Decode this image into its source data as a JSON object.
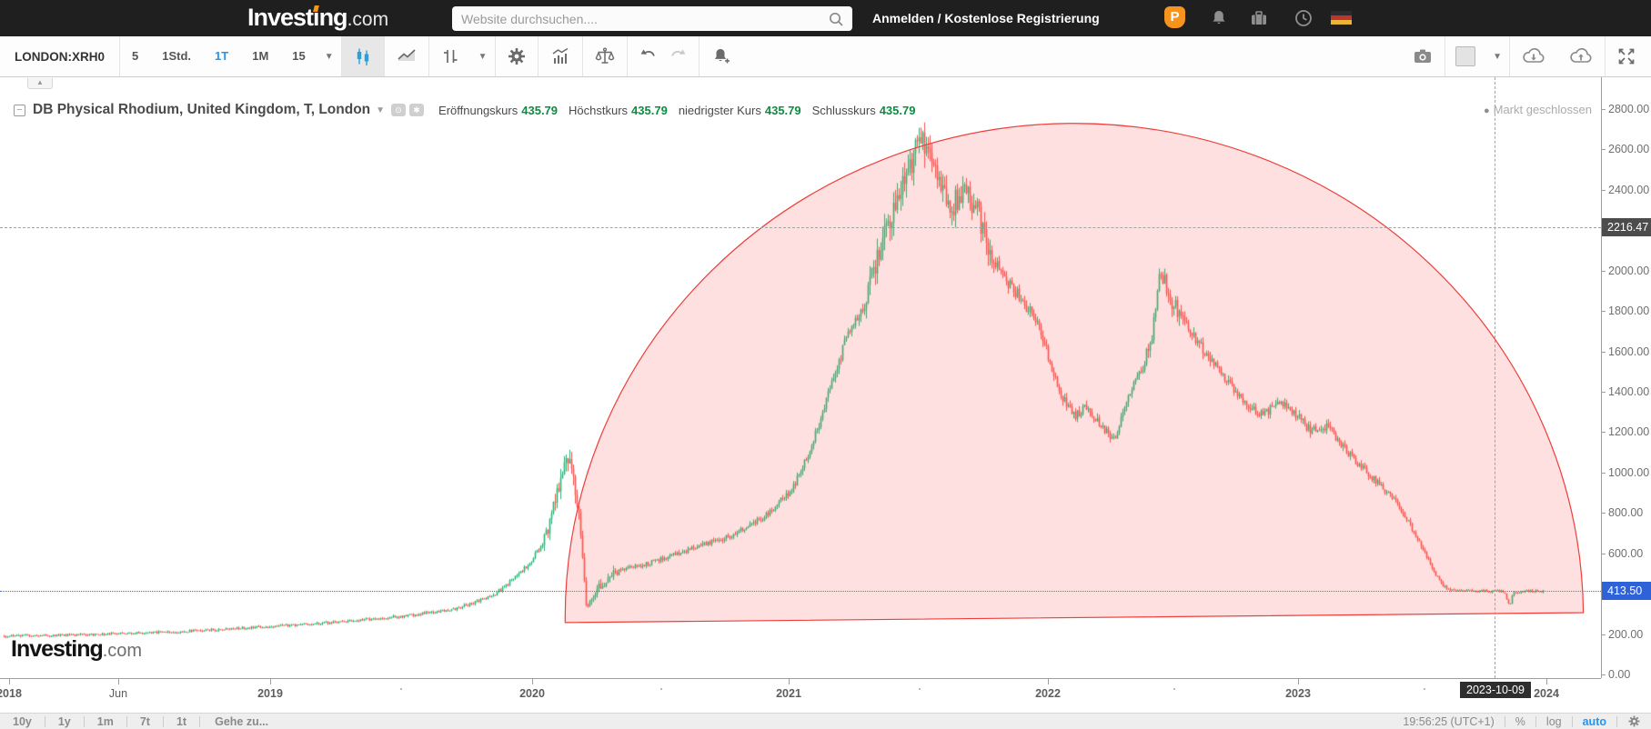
{
  "header": {
    "logo_main": "Investing",
    "logo_suffix": ".com",
    "search_placeholder": "Website durchsuchen....",
    "auth_label": "Anmelden / Kostenlose Registrierung",
    "pro_label": "P",
    "icons": [
      "investing-pro-icon",
      "notifications-bell-icon",
      "portfolio-briefcase-icon",
      "recent-clock-icon",
      "german-flag-icon"
    ]
  },
  "toolbar": {
    "symbol": "LONDON:XRH0",
    "timeframes": [
      {
        "label": "5",
        "active": false
      },
      {
        "label": "1Std.",
        "active": false
      },
      {
        "label": "1T",
        "active": true
      },
      {
        "label": "1M",
        "active": false
      },
      {
        "label": "15",
        "active": false
      }
    ],
    "left_icons": [
      "candlestick-chart-icon",
      "line-chart-icon",
      "bar-interval-icon",
      "settings-gear-icon",
      "indicators-icon",
      "compare-scales-icon",
      "undo-icon",
      "redo-icon",
      "alert-add-icon"
    ],
    "right_icons": [
      "camera-icon",
      "background-swatch-icon",
      "cloud-download-icon",
      "cloud-upload-icon",
      "fullscreen-icon"
    ]
  },
  "chart": {
    "title": "DB Physical Rhodium, United Kingdom, T, London",
    "ohlc": [
      {
        "label": "Eröffnungskurs",
        "value": "435.79"
      },
      {
        "label": "Höchstkurs",
        "value": "435.79"
      },
      {
        "label": "niedrigster Kurs",
        "value": "435.79"
      },
      {
        "label": "Schlusskurs",
        "value": "435.79"
      }
    ],
    "market_status": "Markt geschlossen",
    "watermark_main": "Investing",
    "watermark_suffix": ".com",
    "crosshair_price_label": "2216.47",
    "crosshair_date_label": "2023-10-09",
    "last_price_label": "413.50"
  },
  "chart_data": {
    "type": "candlestick",
    "title": "DB Physical Rhodium, United Kingdom, T, London",
    "interval": "daily",
    "y_axis": {
      "ticks": [
        "2800.00",
        "2600.00",
        "2400.00",
        "2000.00",
        "1800.00",
        "1600.00",
        "1400.00",
        "1200.00",
        "1000.00",
        "800.00",
        "600.00",
        "200.00",
        "0.00"
      ],
      "tick_values": [
        2800,
        2600,
        2400,
        2000,
        1800,
        1600,
        1400,
        1200,
        1000,
        800,
        600,
        200,
        0
      ],
      "range": [
        0,
        2960
      ]
    },
    "x_axis": {
      "labels": [
        "2018",
        "Jun",
        "2019",
        "2020",
        "2021",
        "2022",
        "2023",
        "2024"
      ]
    },
    "last_price": 413.5,
    "crosshair": {
      "date": "2023-10-09",
      "t": 5.69,
      "price": 2216.47
    },
    "series_anchors": [
      [
        0,
        190
      ],
      [
        0.31,
        198
      ],
      [
        0.66,
        212
      ],
      [
        1.0,
        238
      ],
      [
        1.29,
        262
      ],
      [
        1.53,
        292
      ],
      [
        1.71,
        325
      ],
      [
        1.85,
        390
      ],
      [
        1.93,
        470
      ],
      [
        2.0,
        560
      ],
      [
        2.06,
        700
      ],
      [
        2.11,
        950
      ],
      [
        2.14,
        1080
      ],
      [
        2.18,
        820
      ],
      [
        2.21,
        330
      ],
      [
        2.25,
        430
      ],
      [
        2.33,
        510
      ],
      [
        2.47,
        560
      ],
      [
        2.61,
        620
      ],
      [
        2.75,
        680
      ],
      [
        2.89,
        780
      ],
      [
        3.0,
        920
      ],
      [
        3.07,
        1120
      ],
      [
        3.14,
        1400
      ],
      [
        3.21,
        1680
      ],
      [
        3.28,
        1850
      ],
      [
        3.34,
        2150
      ],
      [
        3.41,
        2400
      ],
      [
        3.47,
        2580
      ],
      [
        3.5,
        2650
      ],
      [
        3.55,
        2480
      ],
      [
        3.61,
        2320
      ],
      [
        3.66,
        2420
      ],
      [
        3.71,
        2280
      ],
      [
        3.76,
        2060
      ],
      [
        3.82,
        1950
      ],
      [
        3.87,
        1870
      ],
      [
        3.92,
        1780
      ],
      [
        3.97,
        1620
      ],
      [
        4.02,
        1400
      ],
      [
        4.08,
        1280
      ],
      [
        4.13,
        1330
      ],
      [
        4.18,
        1230
      ],
      [
        4.23,
        1160
      ],
      [
        4.29,
        1380
      ],
      [
        4.34,
        1520
      ],
      [
        4.38,
        1700
      ],
      [
        4.41,
        2000
      ],
      [
        4.44,
        1880
      ],
      [
        4.49,
        1760
      ],
      [
        4.55,
        1650
      ],
      [
        4.6,
        1560
      ],
      [
        4.65,
        1470
      ],
      [
        4.7,
        1390
      ],
      [
        4.76,
        1310
      ],
      [
        4.81,
        1290
      ],
      [
        4.86,
        1350
      ],
      [
        4.91,
        1300
      ],
      [
        4.94,
        1270
      ],
      [
        4.98,
        1210
      ],
      [
        5.05,
        1230
      ],
      [
        5.12,
        1110
      ],
      [
        5.19,
        1010
      ],
      [
        5.24,
        950
      ],
      [
        5.3,
        870
      ],
      [
        5.35,
        780
      ],
      [
        5.38,
        700
      ],
      [
        5.42,
        610
      ],
      [
        5.45,
        520
      ],
      [
        5.49,
        445
      ],
      [
        5.52,
        415
      ],
      [
        5.71,
        412
      ],
      [
        5.73,
        398
      ],
      [
        5.745,
        335
      ],
      [
        5.76,
        404
      ],
      [
        5.8,
        414
      ],
      [
        5.88,
        413
      ]
    ],
    "annotations": [
      {
        "type": "semicircle-drawing",
        "from_t": 2.13,
        "from_price": 257,
        "to_t": 6.03,
        "to_price": 306,
        "apex_price": 2730,
        "stroke": "#ef3e3b",
        "fill": "rgba(244,98,94,0.2)"
      }
    ],
    "colors": {
      "up": "#2eac76",
      "down": "#ef5350",
      "last_price_line": "#4a6fd4"
    }
  },
  "bottom_bar": {
    "ranges": [
      "10y",
      "1y",
      "1m",
      "7t",
      "1t"
    ],
    "goto_label": "Gehe zu...",
    "timestamp": "19:56:25 (UTC+1)",
    "percent_label": "%",
    "log_label": "log",
    "auto_label": "auto"
  }
}
